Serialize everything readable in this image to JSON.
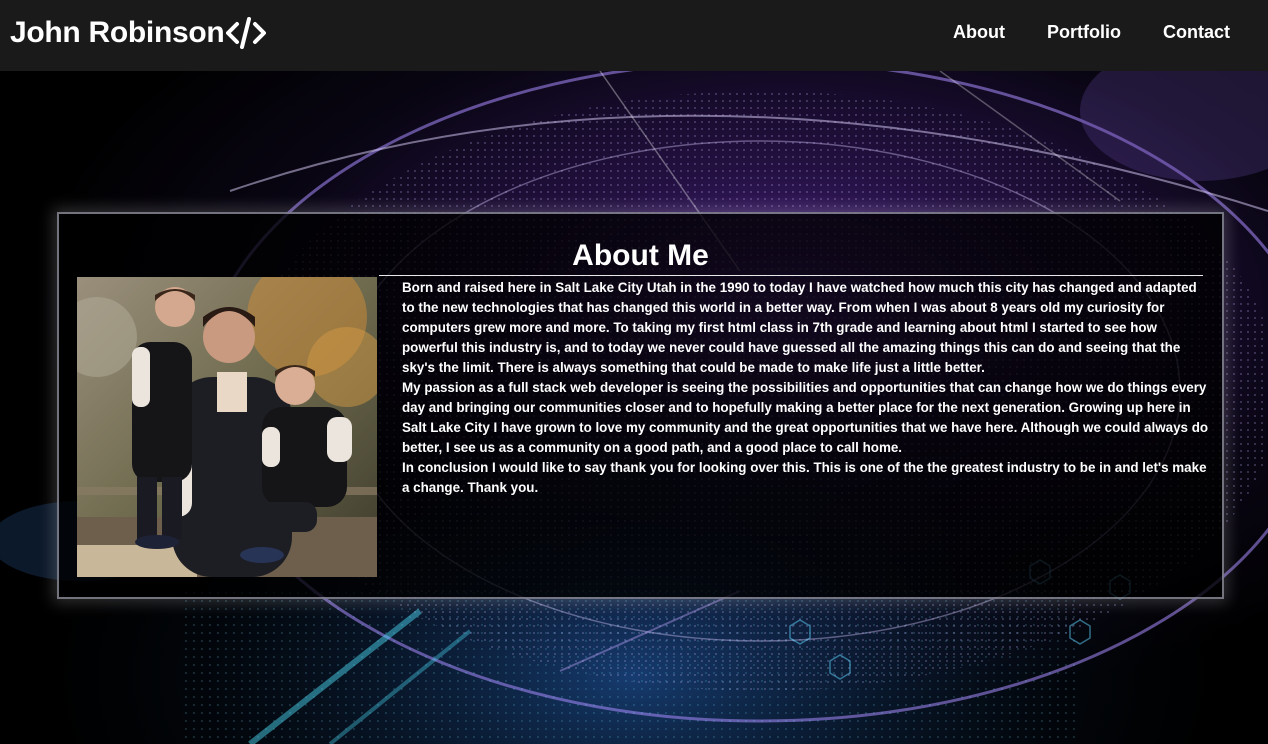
{
  "header": {
    "brand_name": "John Robinson",
    "brand_icon": "code-icon",
    "nav": [
      {
        "label": "About"
      },
      {
        "label": "Portfolio"
      },
      {
        "label": "Contact"
      }
    ]
  },
  "about": {
    "title": "About Me",
    "photo_icon": "family-photo",
    "paragraphs": [
      "Born and raised here in Salt Lake City Utah in the 1990 to today I have watched how much this city has changed and adapted to the new technologies that has changed this world in a better way. From when I was about 8 years old my curiosity for computers grew more and more. To taking my first html class in 7th grade and learning about html I started to see how powerful this industry is, and to today we never could have guessed all the amazing things this can do and seeing that the sky's the limit. There is always something that could be made to make life just a little better.",
      "My passion as a full stack web developer is seeing the possibilities and opportunities that can change how we do things every day and bringing our communities closer and to hopefully making a better place for the next generation. Growing up here in Salt Lake City I have grown to love my community and the great opportunities that we have here. Although we could always do better, I see us as a community on a good path, and a good place to call home.",
      "In conclusion I would like to say thank you for looking over this. This is one of the the greatest industry to be in and let's make a change. Thank you."
    ]
  },
  "colors": {
    "header_bg": "#1b1a1a",
    "text": "#ffffff",
    "accent_purple": "#8a4fd8",
    "accent_cyan": "#3fd6e8"
  }
}
